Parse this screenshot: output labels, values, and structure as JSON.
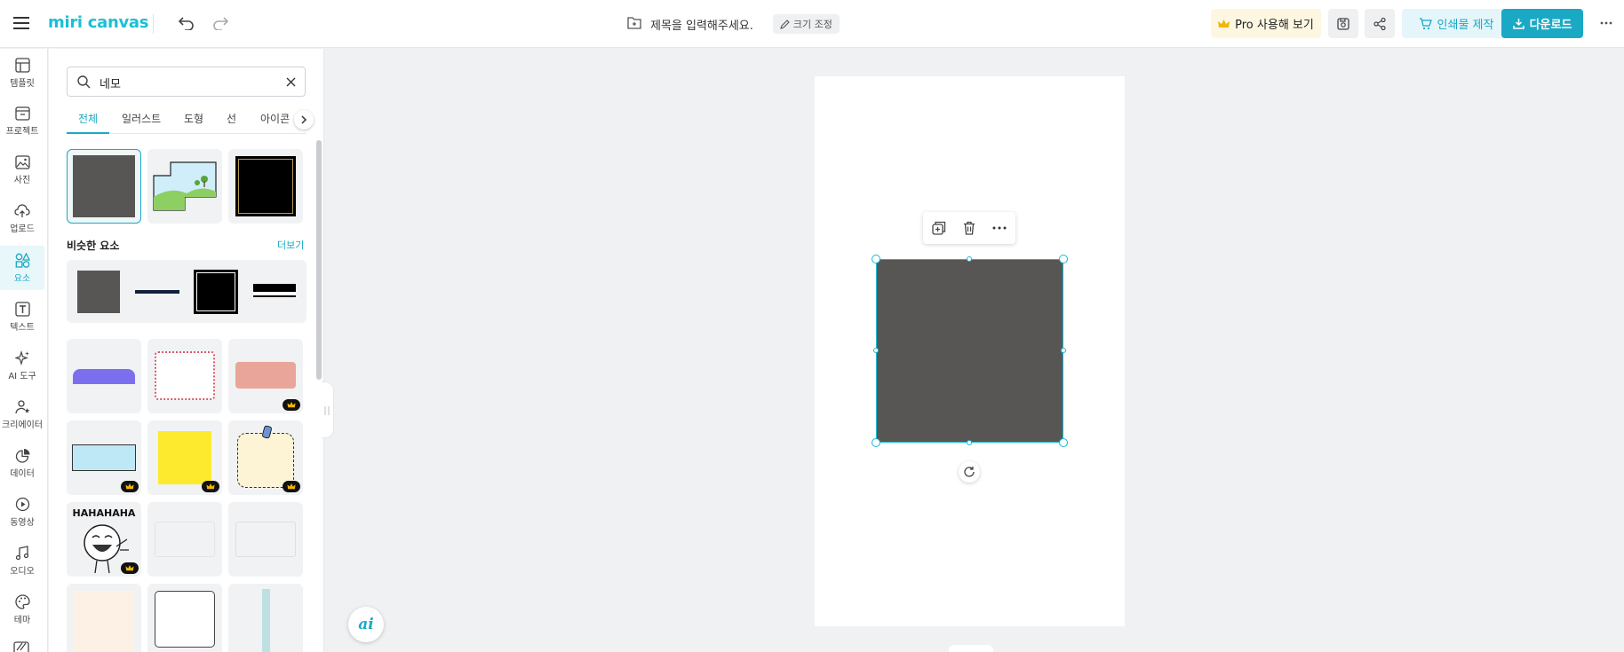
{
  "app": {
    "logo_text": "miri canvas"
  },
  "header": {
    "title_placeholder": "제목을 입력해주세요.",
    "resize_label": "크기 조정",
    "pro_label": "Pro 사용해 보기",
    "print_label": "인쇄물 제작",
    "download_label": "다운로드"
  },
  "nav": [
    {
      "label": "템플릿",
      "icon": "template-icon"
    },
    {
      "label": "프로젝트",
      "icon": "project-icon"
    },
    {
      "label": "사진",
      "icon": "photo-icon"
    },
    {
      "label": "업로드",
      "icon": "upload-icon"
    },
    {
      "label": "요소",
      "icon": "elements-icon",
      "active": true
    },
    {
      "label": "텍스트",
      "icon": "text-icon"
    },
    {
      "label": "AI 도구",
      "icon": "ai-tools-icon"
    },
    {
      "label": "크리에이터",
      "icon": "creator-icon"
    },
    {
      "label": "데이터",
      "icon": "data-icon"
    },
    {
      "label": "동영상",
      "icon": "video-icon"
    },
    {
      "label": "오디오",
      "icon": "audio-icon"
    },
    {
      "label": "테마",
      "icon": "theme-icon"
    }
  ],
  "panel": {
    "search_value": "네모",
    "tabs": [
      "전체",
      "일러스트",
      "도형",
      "선",
      "아이콘"
    ],
    "section_title": "비슷한 요소",
    "section_more": "더보기",
    "sticker_text": "HAHAHAHA"
  },
  "colors": {
    "accent": "#1aa9c4",
    "shape_fill": "#575655",
    "pro_bg": "#fdf7e2"
  }
}
